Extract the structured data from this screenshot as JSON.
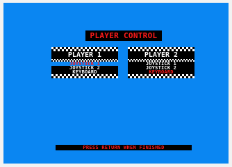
{
  "title": "PLAYER CONTROL",
  "players": [
    {
      "label": "PLAYER 1",
      "options": [
        "JOYSTICK 1",
        "JOYSTICK 2",
        "KEYBOARD"
      ],
      "selected": "JOYSTICK 1"
    },
    {
      "label": "PLAYER 2",
      "options": [
        "JOYSTICK 1",
        "JOYSTICK 2",
        "KEYBOARD"
      ],
      "selected": "KEYBOARD"
    }
  ],
  "footer": "PRESS RETURN WHEN FINISHED",
  "colors": {
    "background": "#0a86f2",
    "panel": "#000000",
    "accent": "#ff1a1a",
    "text": "#ffffff"
  }
}
